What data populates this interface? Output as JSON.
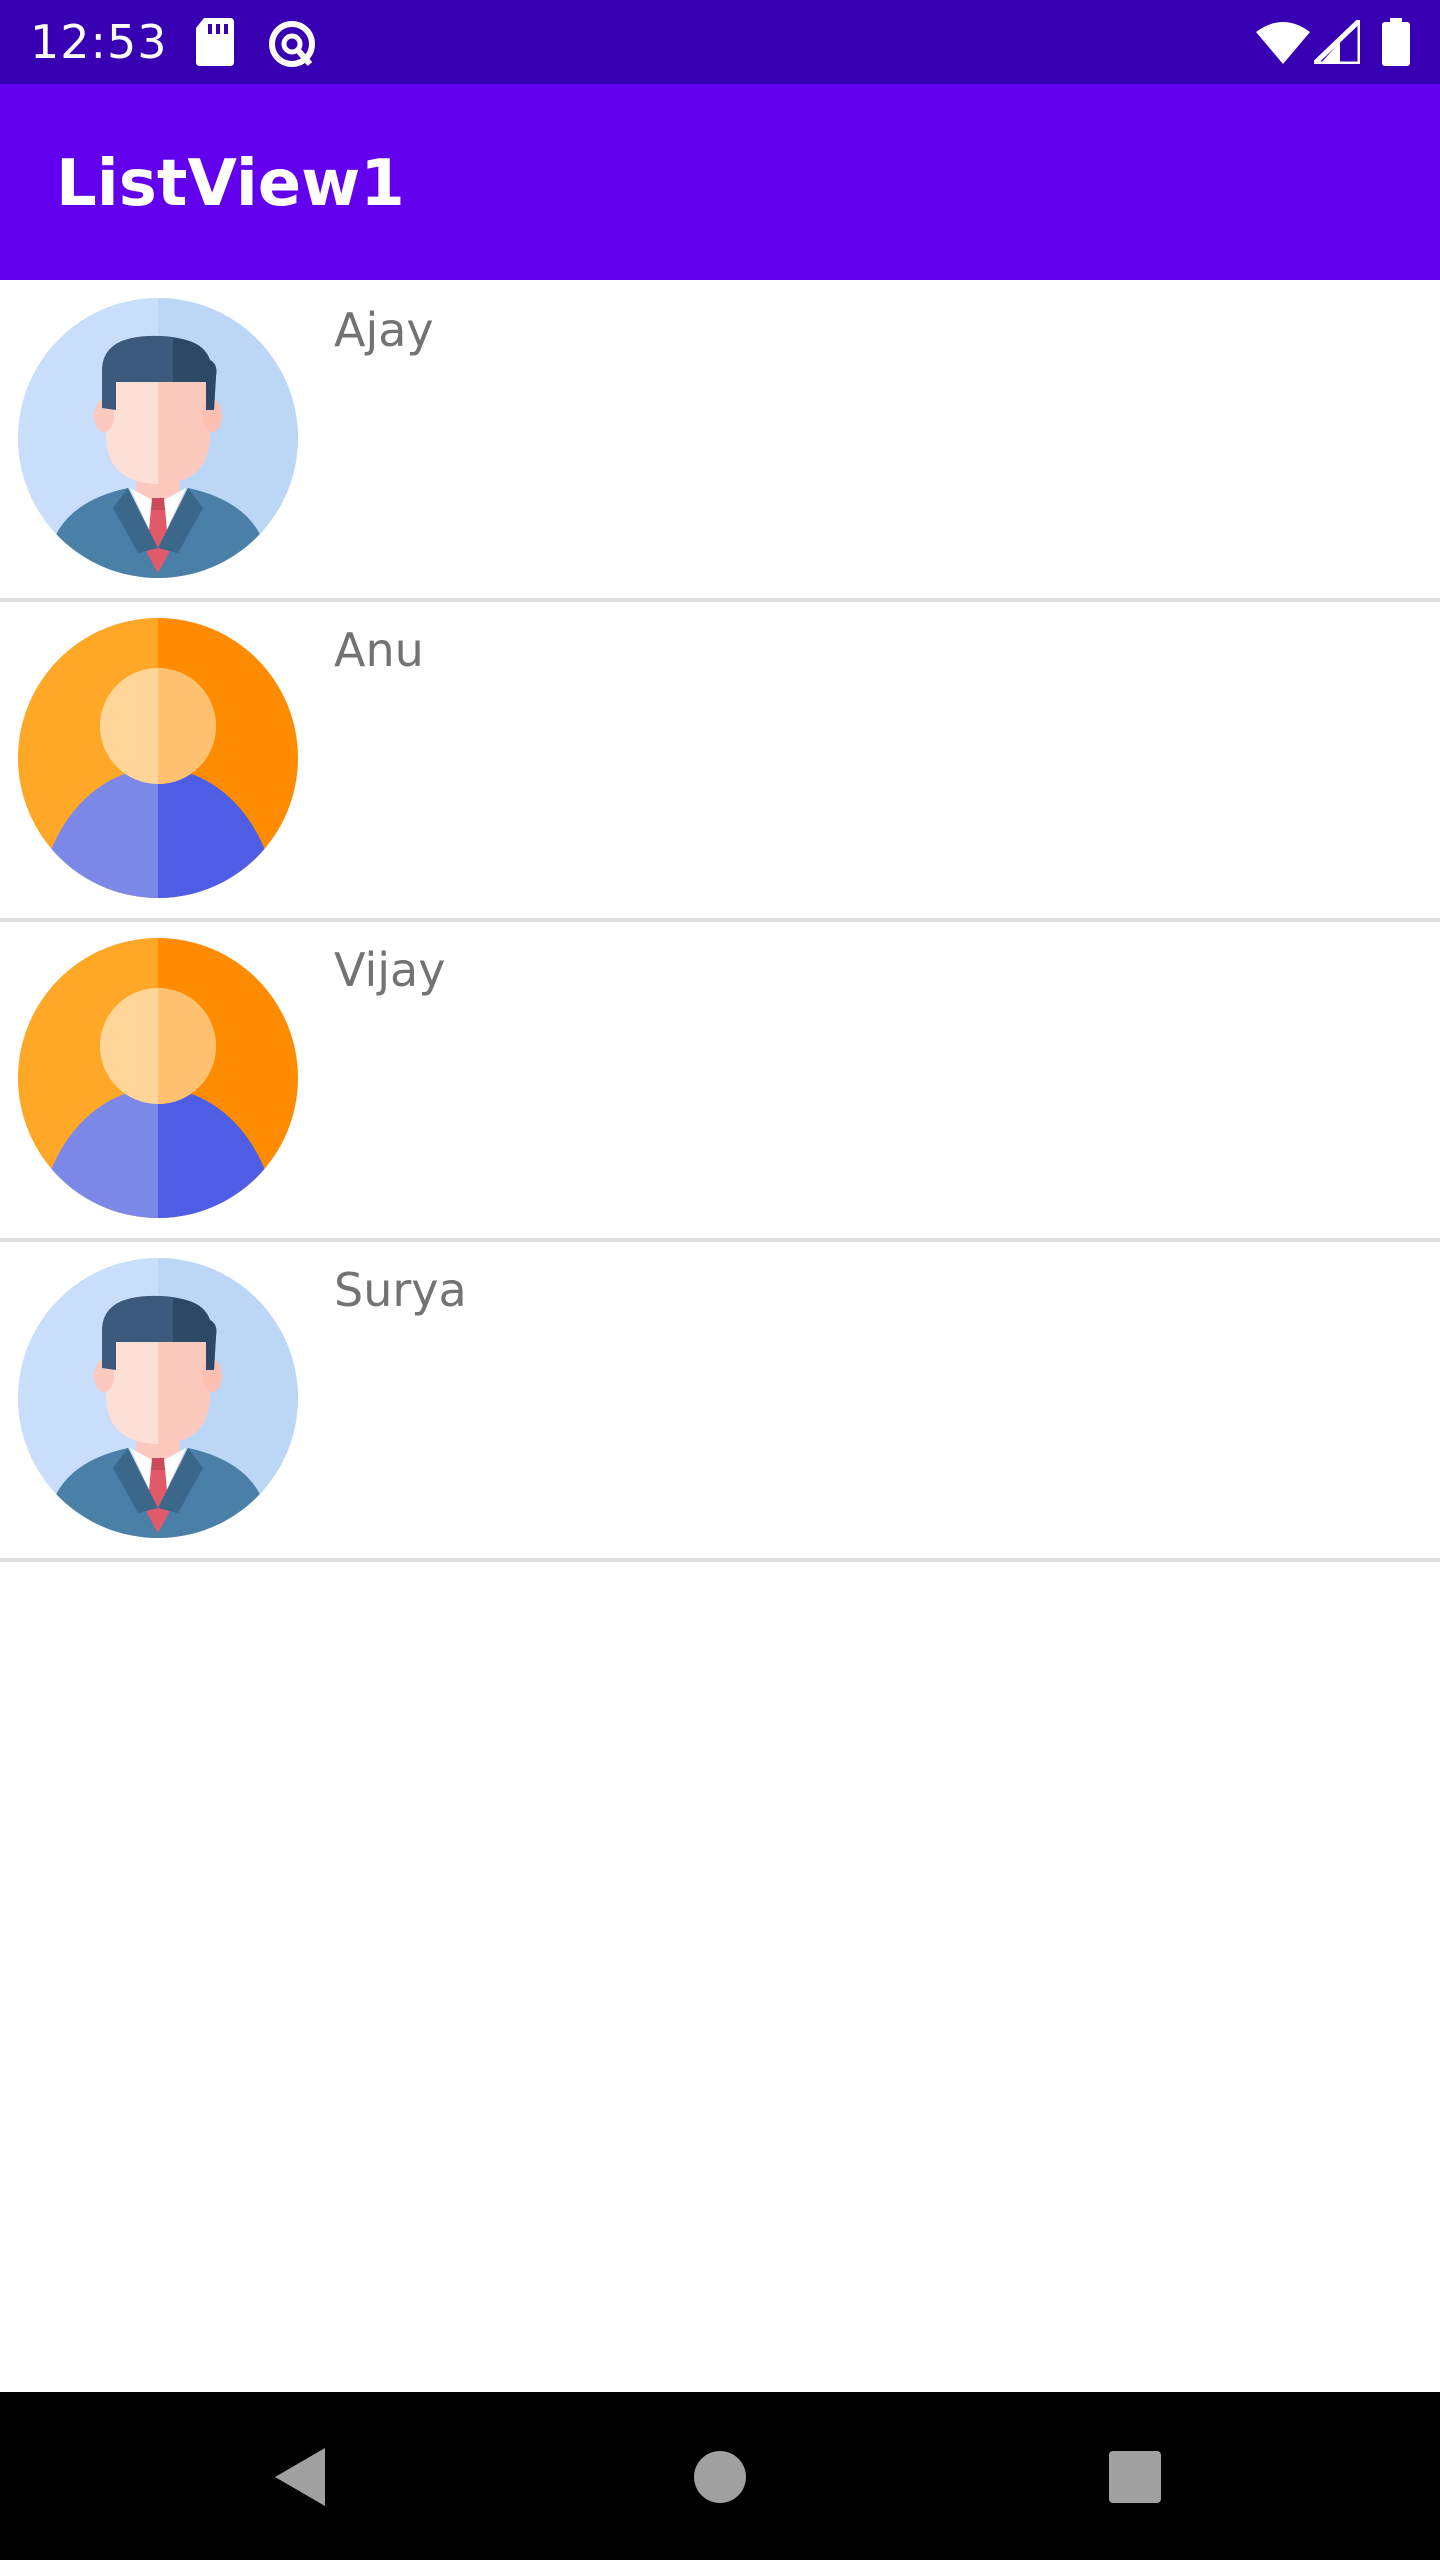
{
  "status_bar": {
    "time": "12:53",
    "background": "#3700b3",
    "icons": [
      "sd-card-icon",
      "sync-icon",
      "wifi-icon",
      "signal-icon",
      "battery-icon"
    ]
  },
  "app_bar": {
    "title": "ListView1",
    "background": "#6200ee"
  },
  "list": {
    "items": [
      {
        "name": "Ajay",
        "avatar": "businessman-avatar-icon"
      },
      {
        "name": "Anu",
        "avatar": "person-avatar-icon"
      },
      {
        "name": "Vijay",
        "avatar": "person-avatar-icon"
      },
      {
        "name": "Surya",
        "avatar": "businessman-avatar-icon"
      }
    ]
  },
  "nav_bar": {
    "buttons": [
      "back-icon",
      "home-icon",
      "recents-icon"
    ]
  }
}
